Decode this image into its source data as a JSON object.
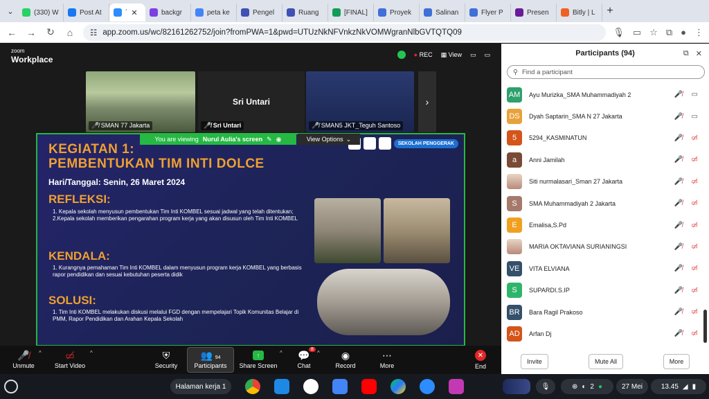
{
  "tabs": [
    {
      "label": "(330) W",
      "color": "#25d366"
    },
    {
      "label": "Post At",
      "color": "#1877f2"
    },
    {
      "label": "´",
      "color": "#2d8cff",
      "active": true
    },
    {
      "label": "backgr",
      "color": "#7b3fe4"
    },
    {
      "label": "peta ke",
      "color": "#4285f4"
    },
    {
      "label": "Pengel",
      "color": "#3f51b5"
    },
    {
      "label": "Ruang",
      "color": "#3f51b5"
    },
    {
      "label": "[FINAL]",
      "color": "#0f9d58"
    },
    {
      "label": "Proyek",
      "color": "#3f6fd8"
    },
    {
      "label": "Salinan",
      "color": "#3f6fd8"
    },
    {
      "label": "Flyer P",
      "color": "#3f6fd8"
    },
    {
      "label": "Presen",
      "color": "#6a1b9a"
    },
    {
      "label": "Bitly | L",
      "color": "#ee6123"
    }
  ],
  "url": "app.zoom.us/wc/82161262752/join?fromPWA=1&pwd=UTUzNkNFVnkzNkVOMWgranNlbGVTQTQ09",
  "zoom": {
    "logo_small": "zoom",
    "logo_big": "Workplace",
    "rec": "REC",
    "view": "View",
    "thumbs": [
      {
        "label": "SMAN 77 Jakarta"
      },
      {
        "label": "Sri Untari",
        "center": "Sri Untari"
      },
      {
        "label": "SMAN5 JKT_Teguh Santoso"
      }
    ],
    "viewing_prefix": "You are viewing",
    "viewing_name": "Nurul Aulia's screen",
    "view_options": "View Options"
  },
  "slide": {
    "title1": "KEGIATAN 1:",
    "title2": "PEMBENTUKAN TIM INTI DOLCE",
    "date": "Hari/Tanggal: Senin, 26 Maret 2024",
    "refleksi_h": "REFLEKSI:",
    "refleksi_1": "1. Kepala sekolah menyusun pembentukan Tim Inti KOMBEL sesuai jadwal yang telah ditentukan;",
    "refleksi_2": "2.Kepala sekolah memberikan pengarahan program kerja yang akan disusun oleh Tim Inti KOMBEL",
    "kendala_h": "KENDALA:",
    "kendala_1": "1. Kurangnya pemahaman Tim Inti KOMBEL dalam menyusun program kerja KOMBEL yang berbasis rapor pendidikan dan sesuai kebutuhan peserta didik",
    "solusi_h": "SOLUSI:",
    "solusi_1": "1. Tim Inti KOMBEL melakukan diskusi melalui FGD dengan mempelajari Topik Komunitas Belajar di PMM, Rapor Pendidikan dan Arahan Kepala Sekolah",
    "badge": "SEKOLAH PENGGERAK"
  },
  "toolbar": {
    "unmute": "Unmute",
    "start_video": "Start Video",
    "security": "Security",
    "participants": "Participants",
    "participants_count": "94",
    "share_screen": "Share Screen",
    "chat": "Chat",
    "chat_badge": "8",
    "record": "Record",
    "more": "More",
    "end": "End"
  },
  "panel": {
    "title": "Participants (94)",
    "search_placeholder": "Find a participant",
    "invite": "Invite",
    "mute_all": "Mute All",
    "more": "More",
    "participants": [
      {
        "initials": "AM",
        "name": "Ayu Murizka_SMA Muhammadiyah 2",
        "color": "#2ea06e",
        "cam": true
      },
      {
        "initials": "DS",
        "name": "Dyah Saptarin_SMA N 27 Jakarta",
        "color": "#e8a23a",
        "cam": true
      },
      {
        "initials": "5",
        "name": "5294_KASMINATUN",
        "color": "#d4541a",
        "cam": false
      },
      {
        "initials": "a",
        "name": "Anni Jamilah",
        "color": "#7a4a36",
        "cam": false
      },
      {
        "initials": "",
        "name": "Siti nurmalasari_Sman 27 Jakarta",
        "color": "#c9a79a",
        "cam": false,
        "photo": true
      },
      {
        "initials": "S",
        "name": "SMA Muhammadiyah 2 Jakarta",
        "color": "#a57a6b",
        "cam": false
      },
      {
        "initials": "E",
        "name": "Emalisa,S.Pd",
        "color": "#f0a020",
        "cam": false
      },
      {
        "initials": "",
        "name": "MARIA OKTAVIANA SURIANINGSI",
        "color": "#c9a79a",
        "cam": false,
        "photo": true
      },
      {
        "initials": "VE",
        "name": "VITA ELVIANA",
        "color": "#34506a",
        "cam": false
      },
      {
        "initials": "S",
        "name": "SUPARDI.S.IP",
        "color": "#2fb56a",
        "cam": false
      },
      {
        "initials": "BR",
        "name": "Bara Ragil Prakoso",
        "color": "#34506a",
        "cam": false
      },
      {
        "initials": "AD",
        "name": "Arfan Dj",
        "color": "#d4541a",
        "cam": false
      }
    ]
  },
  "shelf": {
    "window": "Halaman kerja 1",
    "notif_count": "2",
    "date": "27 Mei",
    "time": "13.45"
  }
}
